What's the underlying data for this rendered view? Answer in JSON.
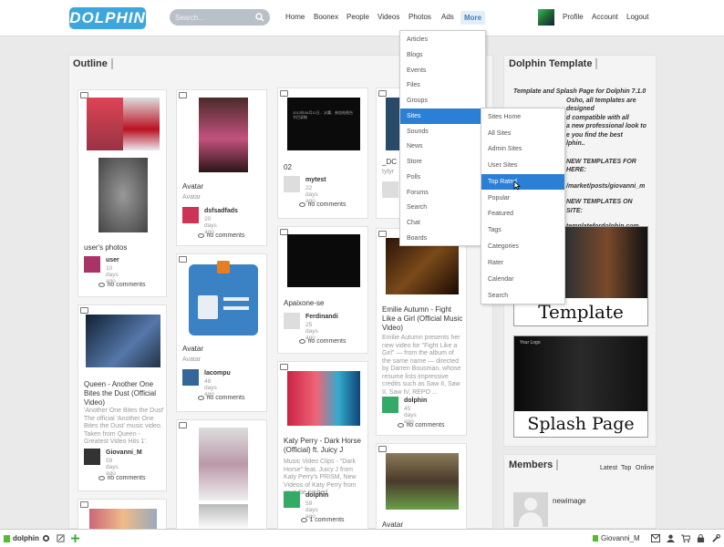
{
  "header": {
    "logo_text": "DOLPHIN",
    "search_placeholder": "Search...",
    "nav": [
      "Home",
      "Boonex",
      "People",
      "Videos",
      "Photos",
      "Ads"
    ],
    "more_label": "More",
    "user_links": [
      "Profile",
      "Account",
      "Logout"
    ]
  },
  "outline": {
    "title": "Outline",
    "cards": [
      {
        "type": "photo",
        "title": "user's photos",
        "subtitle": "",
        "author": "user",
        "time": "10 days ago",
        "comments": "no comments"
      },
      {
        "type": "video",
        "title": "Queen - Another One Bites the Dust (Official Video)",
        "subtitle": "'Another One Bites the Dust' The official 'Another One Bites the Dust' music video. Taken from Queen - Greatest Video Hits 1'.",
        "author": "Giovanni_M",
        "time": "59 days ago",
        "comments": "no comments"
      },
      {
        "type": "photo",
        "title": "Avatar",
        "subtitle": "Avatar",
        "author": "dsfsadfads",
        "time": "20 days ago",
        "comments": "no comments"
      },
      {
        "type": "photo",
        "title": "Avatar",
        "subtitle": "Avatar",
        "author": "lacompu",
        "time": "48 days ago",
        "comments": "no comments"
      },
      {
        "type": "video",
        "title": "02",
        "subtitle": "",
        "author": "mytest",
        "time": "22 days ago",
        "comments": "no comments"
      },
      {
        "type": "video",
        "title": "Apaixone-se",
        "subtitle": "",
        "author": "Ferdinandi",
        "time": "25 days ago",
        "comments": "no comments"
      },
      {
        "type": "video",
        "title": "Katy Perry - Dark Horse (Official) ft. Juicy J",
        "subtitle": "Music Video Clips - \"Dark Horse\" feat. Juicy J from Katy Perry's PRISM, New Videos of Katy Perry from youtube embed",
        "author": "dolphin",
        "time": "59 days ago",
        "comments": "1 comments"
      },
      {
        "type": "video",
        "title": "_DC",
        "subtitle": "tytyr",
        "author": "",
        "time": "",
        "comments": ""
      },
      {
        "type": "video",
        "title": "Emilie Autumn - Fight Like a Girl (Official Music Video)",
        "subtitle": "Emilie Autumn presents her new video for \"Fight Like a Girl\" — from the album of the same name — directed by Darren Bousman, whose resume lists impressive credits such as Saw II, Saw II, Saw IV, REPO ...",
        "author": "dolphin",
        "time": "45 days ago",
        "comments": "no comments"
      },
      {
        "type": "photo",
        "title": "Avatar",
        "subtitle": "",
        "author": "",
        "time": "",
        "comments": ""
      }
    ],
    "video_text": "2013年06月11日... 水翼、参加电视台节目录制"
  },
  "more_menu": {
    "items": [
      "Articles",
      "Blogs",
      "Events",
      "Files",
      "Groups",
      "Sites",
      "Sounds",
      "News",
      "Store",
      "Polls",
      "Forums",
      "Search",
      "Chat",
      "Boards"
    ],
    "active": "Sites"
  },
  "sites_menu": {
    "items": [
      "Sites Home",
      "All Sites",
      "Admin Sites",
      "User Sites",
      "Top Rated",
      "Popular",
      "Featured",
      "Tags",
      "Categories",
      "Rater",
      "Calendar",
      "Search"
    ],
    "active": "Top Rated"
  },
  "sidebar": {
    "title": "Dolphin Template",
    "lines": [
      "Template and Splash Page for Dolphin 7.1.0",
      "Osho, all templates are designed",
      "d compatible with all",
      "a new professional look to",
      "e you find the best",
      "lphin..",
      "NEW TEMPLATES FOR",
      "HERE:",
      "/market/posts/giovanni_m",
      "NEW TEMPLATES ON",
      "SITE:",
      "templatefordolphin.com"
    ],
    "template_label": "Template",
    "splash_label": "Splash Page",
    "splash_small": "Your Logo"
  },
  "members": {
    "title": "Members",
    "tabs": [
      "Latest",
      "Top",
      "Online"
    ],
    "member_name": "newimage"
  },
  "footer": {
    "left_label": "dolphin",
    "user": "Giovanni_M"
  },
  "colors": {
    "accent": "#2b7fd4",
    "more_bg": "#e4eef6",
    "logo": "#3da6dc"
  }
}
